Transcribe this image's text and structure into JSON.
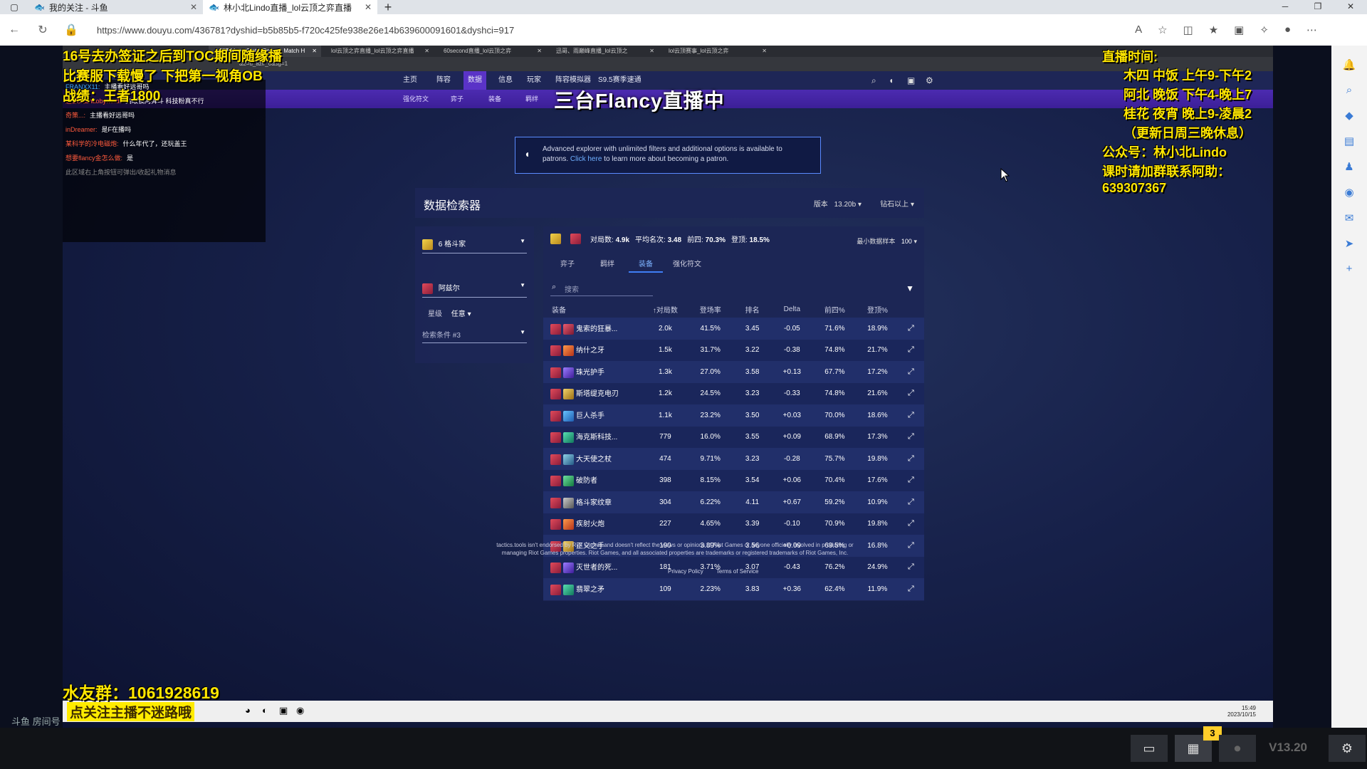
{
  "outer_browser": {
    "tabs": [
      {
        "title": "我的关注 - 斗鱼",
        "active": false
      },
      {
        "title": "林小北Lindo直播_lol云顶之弈直播",
        "active": true
      }
    ],
    "url": "https://www.douyu.com/436781?dyshid=b5b85b5-f720c425fe938e26e14b639600091601&dyshci=917"
  },
  "inner_browser": {
    "tabs": [
      "TFT Meta, Stats, Comps, Match H",
      "lol云顶之弈直播_lol云顶之弈直播",
      "60second直播_lol云顶之弈",
      "迅哥、雨巅峰直播_lol云顶之",
      "lol云顶赛事_lol云顶之弈"
    ],
    "url": "&2=u_azir_0&sg=1"
  },
  "site": {
    "nav": [
      "主页",
      "阵容",
      "数据",
      "信息",
      "玩家",
      "阵容模拟器",
      "S9.5赛季速通"
    ],
    "subnav": [
      "强化符文",
      "弈子",
      "装备",
      "羁绊"
    ],
    "patron_text_1": "Advanced explorer with unlimited filters and additional options is available to",
    "patron_text_2": "patrons.",
    "patron_link": "Click here",
    "patron_text_3": "to learn more about becoming a patron.",
    "explorer_title": "数据检索器",
    "version_label": "版本",
    "version_value": "13.20b",
    "rank_value": "钻石以上",
    "filter_trait": "6 格斗家",
    "filter_unit": "阿兹尔",
    "star_label": "星级",
    "star_value": "任意",
    "filter_cond": "检索条件 #3",
    "stats": {
      "games_label": "对局数:",
      "games_value": "4.9k",
      "avg_label": "平均名次:",
      "avg_value": "3.48",
      "top4_label": "前四:",
      "top4_value": "70.3%",
      "win_label": "登顶:",
      "win_value": "18.5%"
    },
    "min_sample_label": "最小数据样本",
    "min_sample_value": "100",
    "result_tabs": [
      "弈子",
      "羁绊",
      "装备",
      "强化符文"
    ],
    "search_placeholder": "搜索",
    "columns": [
      "装备",
      "对局数",
      "登场率",
      "排名",
      "Delta",
      "前四%",
      "登顶%"
    ],
    "rows": [
      {
        "name": "鬼索的狂暴...",
        "games": "2.0k",
        "rate": "41.5%",
        "place": "3.45",
        "delta": "-0.05",
        "top4": "71.6%",
        "win": "18.9%"
      },
      {
        "name": "纳什之牙",
        "games": "1.5k",
        "rate": "31.7%",
        "place": "3.22",
        "delta": "-0.38",
        "top4": "74.8%",
        "win": "21.7%"
      },
      {
        "name": "珠光护手",
        "games": "1.3k",
        "rate": "27.0%",
        "place": "3.58",
        "delta": "+0.13",
        "top4": "67.7%",
        "win": "17.2%"
      },
      {
        "name": "斯塔缇克电刃",
        "games": "1.2k",
        "rate": "24.5%",
        "place": "3.23",
        "delta": "-0.33",
        "top4": "74.8%",
        "win": "21.6%"
      },
      {
        "name": "巨人杀手",
        "games": "1.1k",
        "rate": "23.2%",
        "place": "3.50",
        "delta": "+0.03",
        "top4": "70.0%",
        "win": "18.6%"
      },
      {
        "name": "海克斯科技...",
        "games": "779",
        "rate": "16.0%",
        "place": "3.55",
        "delta": "+0.09",
        "top4": "68.9%",
        "win": "17.3%"
      },
      {
        "name": "大天使之杖",
        "games": "474",
        "rate": "9.71%",
        "place": "3.23",
        "delta": "-0.28",
        "top4": "75.7%",
        "win": "19.8%"
      },
      {
        "name": "破防者",
        "games": "398",
        "rate": "8.15%",
        "place": "3.54",
        "delta": "+0.06",
        "top4": "70.4%",
        "win": "17.6%"
      },
      {
        "name": "格斗家纹章",
        "games": "304",
        "rate": "6.22%",
        "place": "4.11",
        "delta": "+0.67",
        "top4": "59.2%",
        "win": "10.9%"
      },
      {
        "name": "疾射火炮",
        "games": "227",
        "rate": "4.65%",
        "place": "3.39",
        "delta": "-0.10",
        "top4": "70.9%",
        "win": "19.8%"
      },
      {
        "name": "正义之手",
        "games": "190",
        "rate": "3.89%",
        "place": "3.56",
        "delta": "+0.09",
        "top4": "69.5%",
        "win": "16.8%"
      },
      {
        "name": "灭世者的死...",
        "games": "181",
        "rate": "3.71%",
        "place": "3.07",
        "delta": "-0.43",
        "top4": "76.2%",
        "win": "24.9%"
      },
      {
        "name": "翡翠之矛",
        "games": "109",
        "rate": "2.23%",
        "place": "3.83",
        "delta": "+0.36",
        "top4": "62.4%",
        "win": "11.9%"
      }
    ],
    "footer_line1": "tactics.tools isn't endorsed by Riot Games and doesn't reflect the views or opinions of Riot Games or anyone officially involved in producing or",
    "footer_line2": "managing Riot Games properties. Riot Games, and all associated properties are trademarks or registered trademarks of Riot Games, Inc.",
    "privacy": "Privacy Policy",
    "terms": "Terms of Service"
  },
  "inner_taskbar": {
    "time": "15:49",
    "date": "2023/10/15"
  },
  "chat": [
    {
      "user": "FRANXX11:",
      "msg": "主播看好远哥吗"
    },
    {
      "user": "赵都风Zhaobywind:",
      "msg": "高眼镜阿舜斗 科技粉真不行"
    },
    {
      "user": "奇策...:",
      "msg": "主播看好远哥吗"
    },
    {
      "user": "inDreamer:",
      "msg": "是F在播吗"
    },
    {
      "user": "某科学的冷电磁炮:",
      "msg": "什么年代了，还玩盖王"
    },
    {
      "user": "想要flancy金怎么做:",
      "msg": "是"
    }
  ],
  "chat_system": "此区域右上角按钮可弹出/收起礼物消息",
  "overlay": {
    "left_line1": "16号去办签证之后到TOC期间随缘播",
    "left_line2": "比赛服下载慢了 下把第一视角OB",
    "left_line3": "战绩：王者1800",
    "center_title": "三台Flancy直播中",
    "schedule_title": "直播时间:",
    "schedule_1": "木四 中饭 上午9-下午2",
    "schedule_2": "阿北 晚饭 下午4-晚上7",
    "schedule_3": "桂花 夜宵 晚上9-凌晨2",
    "schedule_4": "（更新日周三晚休息）",
    "public_account": "公众号：林小北Lindo",
    "course": "课时请加群联系阿助：",
    "course_id": "639307367",
    "fan_group": "水友群：1061928619",
    "follow_tip": "点关注主播不迷路哦",
    "room_label": "斗鱼 房间号"
  },
  "player_bar": {
    "version": "V13.20",
    "count": "3"
  }
}
